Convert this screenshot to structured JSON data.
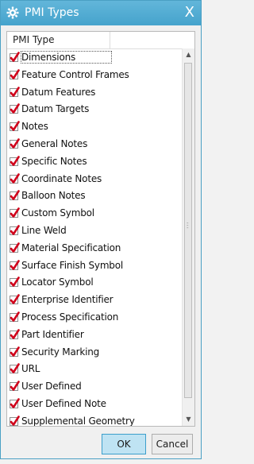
{
  "dialog": {
    "title": "PMI Types",
    "close_symbol": "X",
    "column_header": "PMI Type",
    "items": [
      {
        "label": "Dimensions",
        "checked": true,
        "selected": true
      },
      {
        "label": "Feature Control Frames",
        "checked": true
      },
      {
        "label": "Datum Features",
        "checked": true
      },
      {
        "label": "Datum Targets",
        "checked": true
      },
      {
        "label": "Notes",
        "checked": true
      },
      {
        "label": "General Notes",
        "checked": true
      },
      {
        "label": "Specific Notes",
        "checked": true
      },
      {
        "label": "Coordinate Notes",
        "checked": true
      },
      {
        "label": "Balloon Notes",
        "checked": true
      },
      {
        "label": "Custom Symbol",
        "checked": true
      },
      {
        "label": "Line Weld",
        "checked": true
      },
      {
        "label": "Material Specification",
        "checked": true
      },
      {
        "label": "Surface Finish Symbol",
        "checked": true
      },
      {
        "label": "Locator Symbol",
        "checked": true
      },
      {
        "label": "Enterprise Identifier",
        "checked": true
      },
      {
        "label": "Process Specification",
        "checked": true
      },
      {
        "label": "Part Identifier",
        "checked": true
      },
      {
        "label": "Security Marking",
        "checked": true
      },
      {
        "label": "URL",
        "checked": true
      },
      {
        "label": "User Defined",
        "checked": true
      },
      {
        "label": "User Defined Note",
        "checked": true
      },
      {
        "label": "Supplemental Geometry",
        "checked": true
      }
    ],
    "ok_label": "OK",
    "cancel_label": "Cancel"
  },
  "colors": {
    "titlebar": "#4aa8d0",
    "checkmark": "#d0021b",
    "ok_button": "#bfe3f3",
    "background_highlight": "#f7a21b"
  },
  "icons": {
    "title": "gear-icon",
    "checkbox": "checkmark-icon"
  }
}
